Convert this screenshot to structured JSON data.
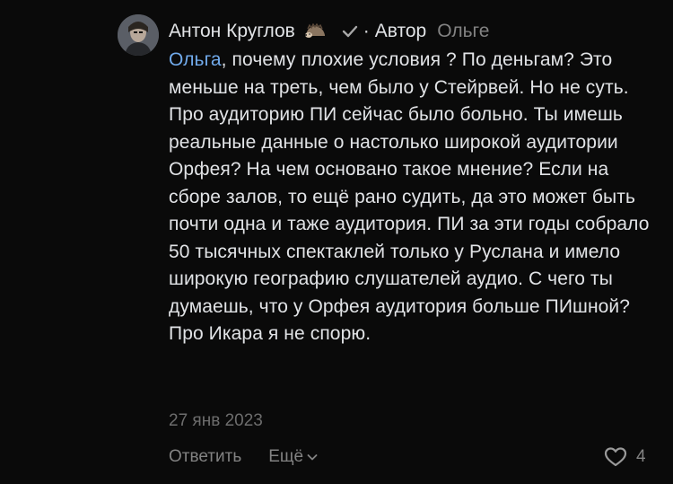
{
  "comment": {
    "author": "Антон Круглов",
    "author_badge_icon": "hedgehog-icon",
    "verified_icon": "checkmark-icon",
    "separator": "·",
    "role_label": "Автор",
    "reply_to": "Ольге",
    "mention": "Ольга",
    "text": ", почему плохие условия ? По деньгам? Это меньше на треть, чем было у Стейрвей. Но не суть. Про аудиторию ПИ сейчас было больно. Ты имешь реальные данные о настолько широкой аудитории Орфея? На чем основано такое мнение? Если на сборе залов, то ещё рано судить, да это может быть почти одна и таже аудитория. ПИ за эти годы собрало 50 тысячных спектаклей только у Руслана и имело широкую географию слушателей аудио. С чего ты думаешь, что у Орфея аудитория больше ПИшной? Про Икара я не спорю.",
    "date": "27 янв 2023"
  },
  "actions": {
    "reply_label": "Ответить",
    "more_label": "Ещё",
    "like_count": "4"
  },
  "colors": {
    "background": "#0a0a0a",
    "text": "#e1e3e6",
    "secondary": "#828282",
    "mention": "#71aaeb"
  }
}
